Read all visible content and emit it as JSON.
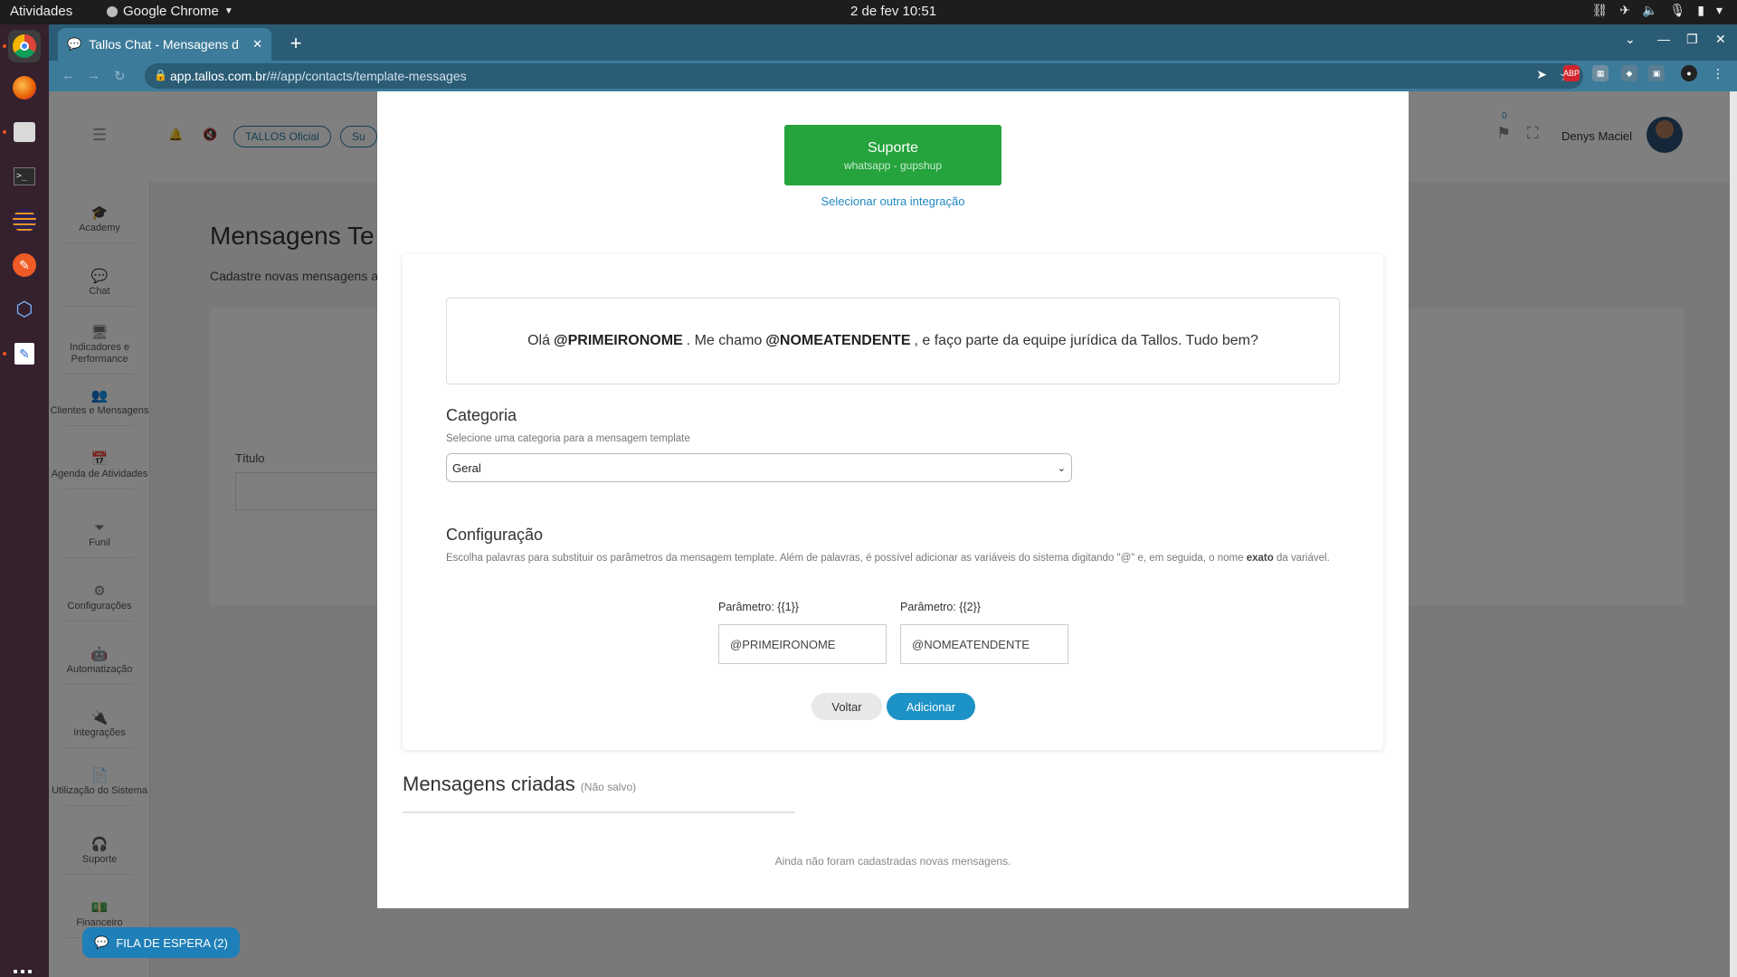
{
  "system": {
    "activities": "Atividades",
    "app_name": "Google Chrome",
    "clock": "2 de fev  10:51"
  },
  "browser": {
    "tab_title": "Tallos Chat - Mensagens d",
    "url_host": "app.tallos.com.br",
    "url_path": "/#/app/contacts/template-messages"
  },
  "app": {
    "header_buttons": [
      "TALLOS Oficial",
      "Su"
    ],
    "notification_count": "0",
    "user_name": "Denys Maciel",
    "page_title": "Mensagens Te",
    "page_subtitle": "Cadastre novas mensagens a",
    "title_label": "Título",
    "sidebar": [
      {
        "label": "Academy",
        "icon": "graduation-icon"
      },
      {
        "label": "Chat",
        "icon": "chat-icon"
      },
      {
        "label": "Indicadores e Performance",
        "icon": "monitor-icon"
      },
      {
        "label": "Clientes e Mensagens",
        "icon": "people-icon"
      },
      {
        "label": "Agenda de Atividades",
        "icon": "calendar-icon"
      },
      {
        "label": "Funil",
        "icon": "funnel-icon"
      },
      {
        "label": "Configurações",
        "icon": "gears-icon"
      },
      {
        "label": "Automatização",
        "icon": "robot-icon"
      },
      {
        "label": "Integrações",
        "icon": "plug-icon"
      },
      {
        "label": "Utilização do Sistema",
        "icon": "document-icon"
      },
      {
        "label": "Suporte",
        "icon": "headset-icon"
      },
      {
        "label": "Financeiro",
        "icon": "money-icon"
      }
    ],
    "queue_button": "FILA DE ESPERA (2)"
  },
  "modal": {
    "integration_name": "Suporte",
    "integration_type": "whatsapp - gupshup",
    "select_other": "Selecionar outra integração",
    "preview": {
      "part1": "Olá",
      "var1": "@PRIMEIRONOME",
      "part2": ". Me chamo",
      "var2": "@NOMEATENDENTE",
      "part3": ", e faço parte da equipe jurídica da Tallos. Tudo bem?"
    },
    "category": {
      "title": "Categoria",
      "help": "Selecione uma categoria para a mensagem template",
      "selected": "Geral"
    },
    "configuration": {
      "title": "Configuração",
      "help_part1": "Escolha palavras para substituir os parâmetros da mensagem template. Além de palavras, é possível adicionar as variáveis do sistema digitando \"@\" e, em seguida, o nome",
      "help_bold": "exato",
      "help_part2": "da variável.",
      "params": [
        {
          "label": "Parâmetro: {{1}}",
          "value": "@PRIMEIRONOME"
        },
        {
          "label": "Parâmetro: {{2}}",
          "value": "@NOMEATENDENTE"
        }
      ]
    },
    "back_button": "Voltar",
    "add_button": "Adicionar",
    "created_title": "Mensagens criadas",
    "created_sub": "(Não salvo)",
    "empty_message": "Ainda não foram cadastradas novas mensagens."
  }
}
